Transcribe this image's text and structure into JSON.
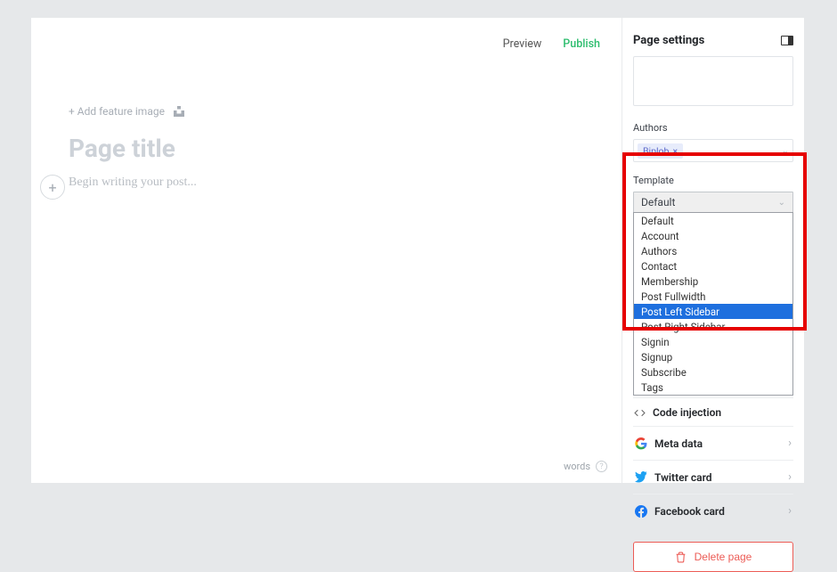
{
  "topbar": {
    "preview": "Preview",
    "publish": "Publish"
  },
  "editor": {
    "add_feature_image": "+ Add feature image",
    "title_placeholder": "Page title",
    "body_placeholder": "Begin writing your post...",
    "words_label": "words"
  },
  "sidebar": {
    "title": "Page settings",
    "authors_label": "Authors",
    "author_tag": "Biplob",
    "template_label": "Template",
    "template_selected": "Default",
    "template_options": [
      "Default",
      "Account",
      "Authors",
      "Contact",
      "Membership",
      "Post Fullwidth",
      "Post Left Sidebar",
      "Post Right Sidebar",
      "Signin",
      "Signup",
      "Subscribe",
      "Tags"
    ],
    "template_highlighted_index": 6,
    "code_injection": "Code injection",
    "meta_data": "Meta data",
    "twitter_card": "Twitter card",
    "facebook_card": "Facebook card",
    "delete_page": "Delete page"
  }
}
